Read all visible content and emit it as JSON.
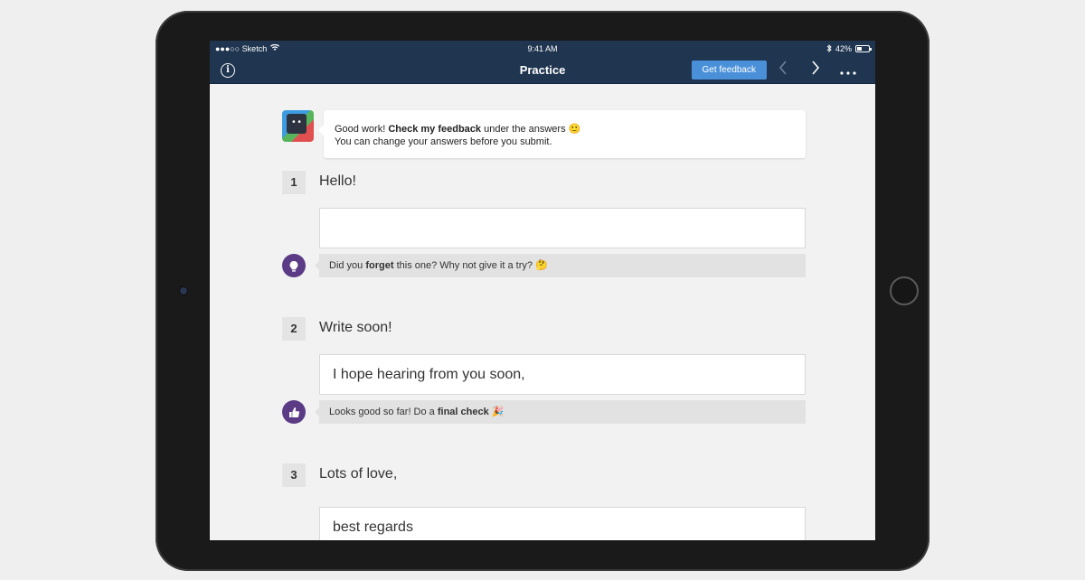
{
  "statusbar": {
    "carrier": "●●●○○ Sketch",
    "time": "9:41 AM",
    "battery": "42%"
  },
  "navbar": {
    "title": "Practice",
    "info_icon": "info-icon",
    "feedback_label": "Get feedback",
    "prev_icon": "chevron-left-icon",
    "next_icon": "chevron-right-icon",
    "more_icon": "more-icon"
  },
  "intro": {
    "line1_pre": "Good work! ",
    "line1_bold": "Check my feedback",
    "line1_post": " under the answers 🙂",
    "line2": "You can change your answers before you submit."
  },
  "questions": [
    {
      "number": "1",
      "prompt": "Hello!",
      "answer": "",
      "feedback_pre": "Did you ",
      "feedback_bold": "forget",
      "feedback_post": " this one? Why not give it a try? 🤔",
      "feedback_icon": "lightbulb-icon"
    },
    {
      "number": "2",
      "prompt": "Write soon!",
      "answer": "I hope hearing from you soon,",
      "feedback_pre": "Looks good so far! Do a ",
      "feedback_bold": "final check",
      "feedback_post": " 🎉",
      "feedback_icon": "thumbs-up-icon"
    },
    {
      "number": "3",
      "prompt": "Lots of love,",
      "answer": "best regards"
    }
  ],
  "colors": {
    "navbar": "#1f3550",
    "accent": "#4a90d9",
    "feedback_icon": "#5b3a86"
  }
}
